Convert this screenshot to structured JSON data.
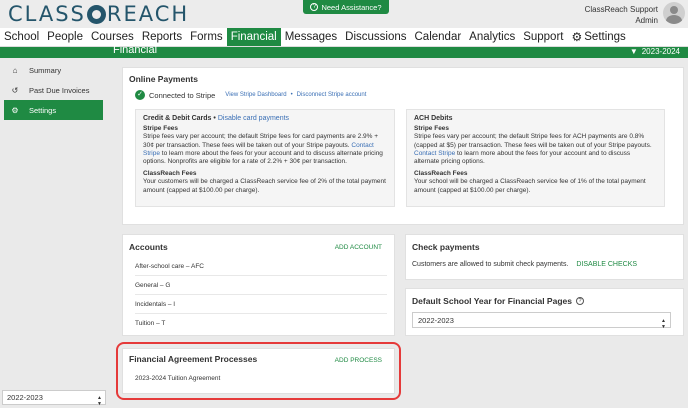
{
  "header": {
    "logo_left": "CLASS",
    "logo_right": "REACH",
    "assistance": "Need Assistance?",
    "user_name": "ClassReach Support",
    "user_role": "Admin"
  },
  "nav": {
    "tabs": [
      "School",
      "People",
      "Courses",
      "Reports",
      "Forms",
      "Financial",
      "Messages",
      "Discussions",
      "Calendar",
      "Analytics",
      "Support",
      "Settings"
    ],
    "active": "Financial"
  },
  "subbar": {
    "title": "Financial",
    "year": "2023-2024"
  },
  "sidebar": {
    "items": [
      {
        "label": "Summary",
        "icon": "home-icon"
      },
      {
        "label": "Past Due Invoices",
        "icon": "history-icon"
      },
      {
        "label": "Settings",
        "icon": "gear-icon"
      }
    ],
    "year_select": "2022-2023"
  },
  "online_payments": {
    "title": "Online Payments",
    "connected": "Connected to Stripe",
    "view_dashboard": "View Stripe Dashboard",
    "separator": "•",
    "disconnect": "Disconnect Stripe account",
    "cards": {
      "heading": "Credit & Debit Cards",
      "heading_sep": "•",
      "disable_link": "Disable card payments",
      "stripe_fees_title": "Stripe Fees",
      "stripe_fees_pre": "Stripe fees vary per account; the default Stripe fees for card payments are 2.9% + 30¢ per transaction. These fees will be taken out of your Stripe payouts.",
      "contact": "Contact Stripe",
      "stripe_fees_post": "to learn more about the fees for your account and to discuss alternate pricing options. Nonprofits are eligible for a rate of 2.2% + 30¢ per transaction.",
      "cr_fees_title": "ClassReach Fees",
      "cr_fees": "Your customers will be charged a ClassReach service fee of 2% of the total payment amount (capped at $100.00 per charge)."
    },
    "ach": {
      "heading": "ACH Debits",
      "stripe_fees_title": "Stripe Fees",
      "stripe_fees_pre": "Stripe fees vary per account; the default Stripe fees for ACH payments are 0.8% (capped at $5) per transaction. These fees will be taken out of your Stripe payouts.",
      "contact": "Contact Stripe",
      "stripe_fees_post": "to learn more about the fees for your account and to discuss alternate pricing options.",
      "cr_fees_title": "ClassReach Fees",
      "cr_fees": "Your school will be charged a ClassReach service fee of 1% of the total payment amount (capped at $100.00 per charge)."
    }
  },
  "accounts": {
    "title": "Accounts",
    "add": "ADD ACCOUNT",
    "rows": [
      "After-school care – AFC",
      "General – G",
      "Incidentals – I",
      "Tuition – T"
    ]
  },
  "check_payments": {
    "title": "Check payments",
    "text": "Customers are allowed to submit check payments.",
    "disable": "DISABLE CHECKS"
  },
  "default_year": {
    "title": "Default School Year for Financial Pages",
    "selected": "2022-2023"
  },
  "agreements": {
    "title": "Financial Agreement Processes",
    "add": "ADD PROCESS",
    "rows": [
      "2023-2024 Tuition Agreement"
    ]
  }
}
